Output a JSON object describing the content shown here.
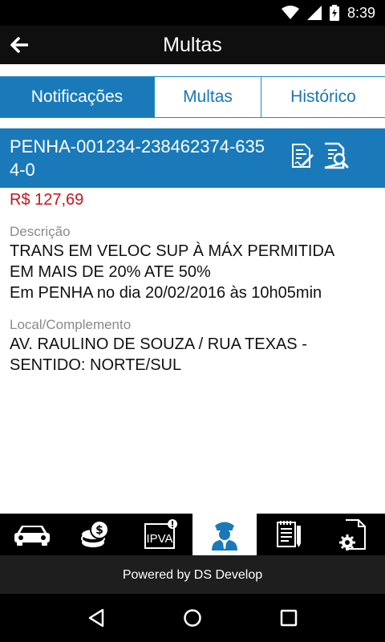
{
  "status_bar": {
    "time": "8:39",
    "icons": [
      "wifi-icon",
      "signal-icon",
      "battery-icon"
    ]
  },
  "app_bar": {
    "title": "Multas",
    "back_icon": "arrow-left-icon"
  },
  "tabs": [
    {
      "label": "Notificações",
      "active": true
    },
    {
      "label": "Multas",
      "active": false
    },
    {
      "label": "Histórico",
      "active": false
    }
  ],
  "fine": {
    "id": "PENHA-001234-238462374-6354-0",
    "amount": "R$ 127,69",
    "description_label": "Descrição",
    "description_lines": [
      "TRANS EM VELOC SUP À MÁX PERMITIDA",
      "EM MAIS DE 20% ATE 50%"
    ],
    "occurrence": "Em PENHA no dia 20/02/2016 às 10h05min",
    "location_label": "Local/Complemento",
    "location_lines": [
      "AV. RAULINO DE SOUZA / RUA TEXAS -",
      "SENTIDO: NORTE/SUL"
    ]
  },
  "bottom_nav": {
    "items": [
      "car-icon",
      "coins-icon",
      "ipva-icon",
      "officer-icon",
      "document-icon",
      "settings-file-icon"
    ],
    "ipva_text": "IPVA",
    "active_index": 3
  },
  "footer": {
    "text": "Powered by DS Develop"
  },
  "colors": {
    "accent": "#1a7ab9",
    "amount": "#c4161c",
    "label": "#8a8a8a"
  }
}
